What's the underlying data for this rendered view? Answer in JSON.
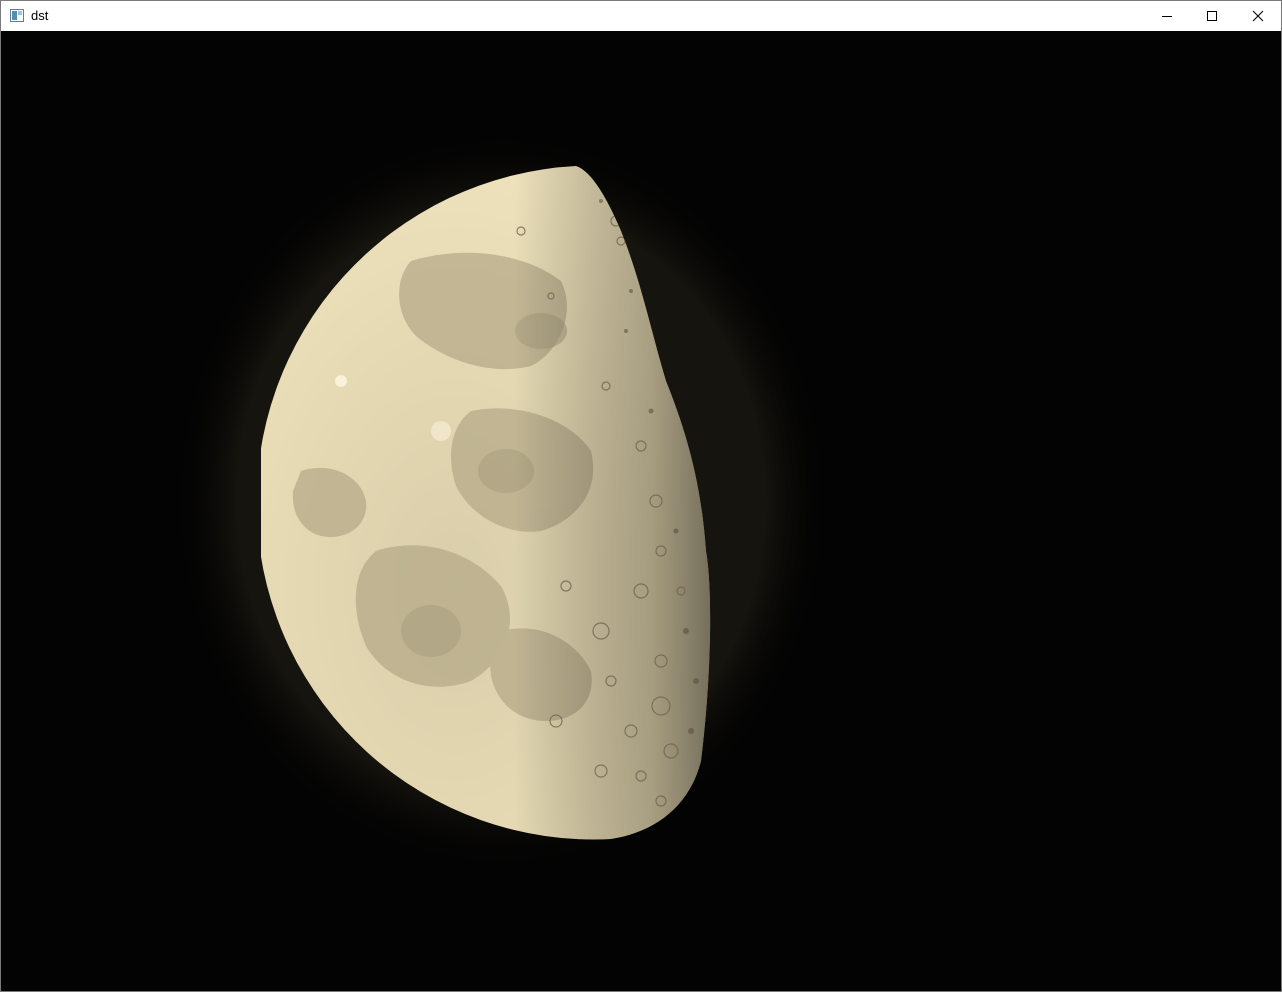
{
  "window": {
    "title": "dst",
    "icon": "opencv-window-icon",
    "controls": {
      "minimize_icon": "minimize-icon",
      "maximize_icon": "maximize-icon",
      "close_icon": "close-icon"
    }
  },
  "image": {
    "subject": "moon",
    "background_color": "#030303",
    "moon_lit_color": "#e8dcb4",
    "mare_color": "#b9ad8e",
    "terminator_color": "#8f8466"
  }
}
